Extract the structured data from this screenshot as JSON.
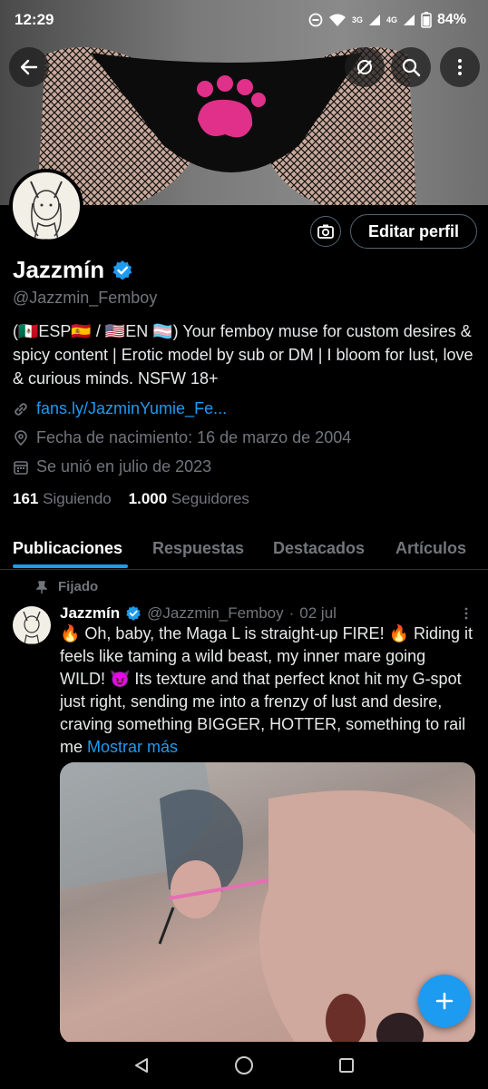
{
  "status": {
    "time": "12:29",
    "battery": "84%",
    "net1": "3G",
    "net2": "4G"
  },
  "profile": {
    "name": "Jazzmín",
    "handle": "@Jazzmin_Femboy",
    "edit_label": "Editar perfil",
    "bio": "(🇲🇽ESP🇪🇸 / 🇺🇸EN 🏳️‍⚧️) Your femboy muse for custom desires & spicy content | Erotic model by sub or DM | I bloom for lust, love & curious minds. NSFW 18+",
    "link": "fans.ly/JazminYumie_Fe...",
    "birth": "Fecha de nacimiento: 16 de marzo de 2004",
    "joined": "Se unió en julio de 2023",
    "following_count": "161",
    "following_label": "Siguiendo",
    "followers_count": "1.000",
    "followers_label": "Seguidores"
  },
  "tabs": [
    "Publicaciones",
    "Respuestas",
    "Destacados",
    "Artículos"
  ],
  "post": {
    "pinned_label": "Fijado",
    "name": "Jazzmín",
    "handle": "@Jazzmin_Femboy",
    "dot": "·",
    "date": "02 jul",
    "text": "🔥 Oh, baby, the Maga L is straight-up FIRE! 🔥 Riding it feels like taming a wild beast, my inner mare going WILD! 😈 Its texture and that perfect knot hit my G-spot just right, sending me into a frenzy of lust and desire, craving something BIGGER, HOTTER, something to rail me",
    "more_label": "Mostrar más"
  },
  "colors": {
    "accent": "#1d9bf0",
    "muted": "#71767b",
    "bg": "#000000"
  },
  "icons": [
    "back-arrow-icon",
    "hide-icon",
    "search-icon",
    "more-vertical-icon",
    "camera-icon",
    "verified-icon",
    "link-icon",
    "location-icon",
    "calendar-icon",
    "pin-icon",
    "plus-icon"
  ]
}
